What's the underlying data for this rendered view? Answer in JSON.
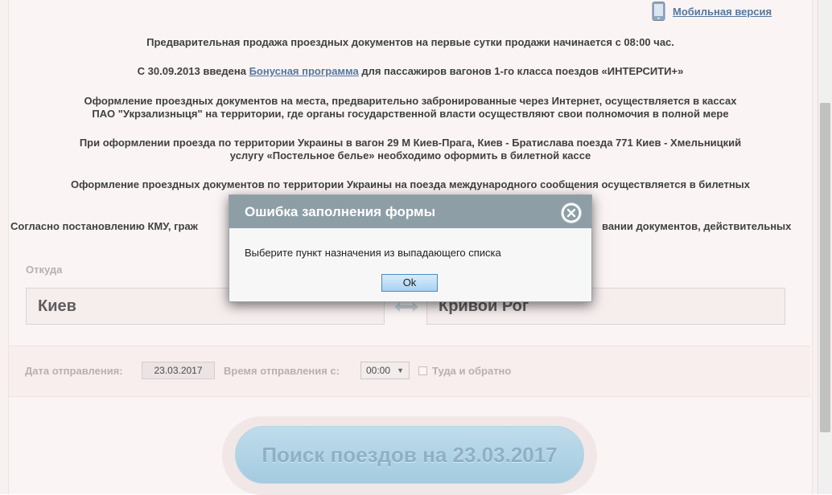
{
  "header": {
    "mobile_link": "Мобильная версия",
    "mobile_icon": "phone-icon"
  },
  "notices": {
    "n1": "Предварительная продажа проездных документов на первые сутки продажи начинается с 08:00 час.",
    "n2_pre": "С 30.09.2013 введена ",
    "n2_link": "Бонусная программа",
    "n2_post": " для пассажиров вагонов 1-го класса поездов «ИНТЕРСИТИ+»",
    "n3_line1": "Оформление проездных документов на места, предварительно забронированные через Интернет, осуществляется в кассах",
    "n3_line2": "ПАО \"Укрзализныця\" на территории, где органы государственной власти осуществляют свои полномочия в полной мере",
    "n4_line1": "При оформлении проезда по территории Украины в вагон 29 М Киев-Прага, Киев - Братислава поезда 771 Киев - Хмельницкий",
    "n4_line2": "услугу «Постельное белье» необходимо оформить в билетной кассе",
    "n5_line1": "Оформление проездных документов по территории Украины на поезда международного сообщения осуществляется в билетных",
    "n6_left": "Согласно постановлению КМУ, граж",
    "n6_right": "вании документов, действительных"
  },
  "form": {
    "from_label": "Откуда",
    "from_value": "Киев",
    "to_value": "Кривой Рог",
    "date_label": "Дата отправления:",
    "date_value": "23.03.2017",
    "time_label": "Время отправления с:",
    "time_value": "00:00",
    "roundtrip_label": "Туда и обратно",
    "search_button": "Поиск поездов на 23.03.2017"
  },
  "dialog": {
    "title": "Ошибка заполнения формы",
    "message": "Выберите пункт назначения из выпадающего списка",
    "ok_label": "Ok"
  },
  "colors": {
    "link": "#5577a0",
    "dialog_header": "#8e9ea6",
    "search_button": "#a4cbe0"
  }
}
